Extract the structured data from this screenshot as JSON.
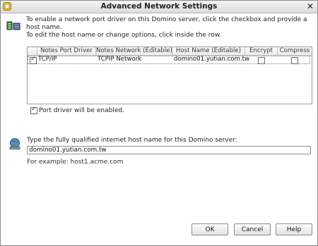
{
  "window": {
    "title": "Advanced Network Settings",
    "icon": "notes-window-icon",
    "close_glyph": "✕"
  },
  "intro": {
    "line1": "To enable a network port driver on this Domino server, click the checkbox and provide a host name.",
    "line2": "To edit the host name or change options, click inside the row."
  },
  "table": {
    "columns": [
      "Notes Port Driver",
      "Notes Network (Editable)",
      "Host Name (Editable)",
      "Encrypt",
      "Compress"
    ],
    "rows": [
      {
        "enabled": true,
        "port_driver": "TCP/IP",
        "network": "TCPIP Network",
        "host_name": "domino01.yutian.com.tw",
        "encrypt": false,
        "compress": false
      }
    ]
  },
  "port_driver_checkbox": {
    "checked": true,
    "label": "Port driver will be enabled."
  },
  "host": {
    "label": "Type the fully qualified internet host name for this Domino server:",
    "value": "domino01.yutian.com.tw",
    "example": "For example: host1.acme.com"
  },
  "buttons": {
    "ok": "OK",
    "cancel": "Cancel",
    "help": "Help"
  }
}
